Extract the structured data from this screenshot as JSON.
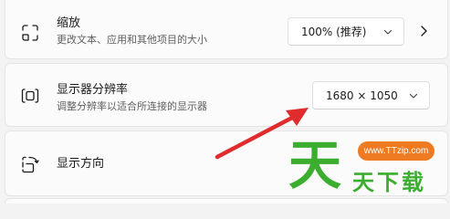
{
  "scale": {
    "title": "缩放",
    "subtitle": "更改文本、应用和其他项目的大小",
    "value": "100% (推荐)",
    "icon": "scale-icon"
  },
  "resolution": {
    "title": "显示器分辨率",
    "subtitle": "调整分辨率以适合所连接的显示器",
    "value": "1680 × 1050",
    "icon": "resolution-icon"
  },
  "orientation": {
    "title": "显示方向",
    "icon": "rotate-display-icon"
  },
  "watermark": {
    "big_char": "天",
    "url": "www.TTzip.com",
    "text": "天下载",
    "colors": {
      "green": "#3cae2f",
      "orange": "#ee7a22"
    }
  },
  "annotation": {
    "arrow_color": "#e02c2c"
  }
}
